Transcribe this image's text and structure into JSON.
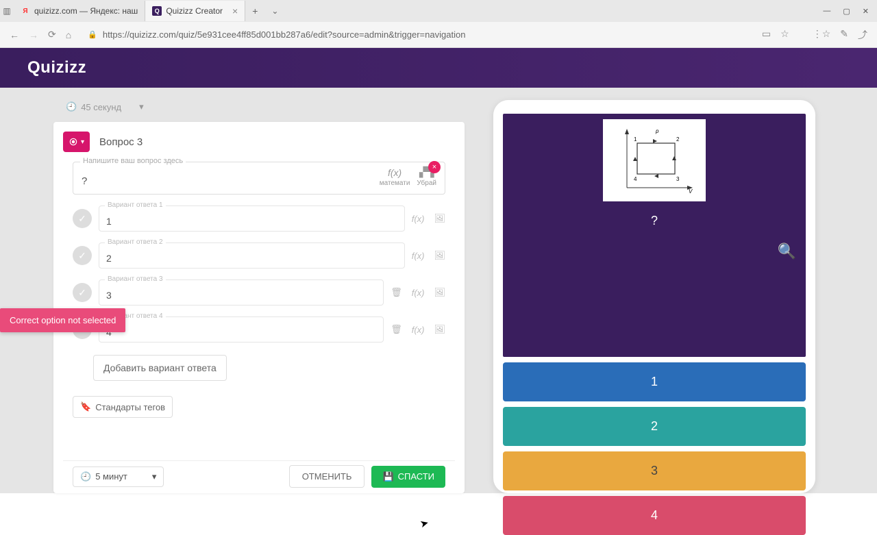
{
  "browser": {
    "tab1": "quizizz.com — Яндекс: наш",
    "tab2": "Quizizz Creator",
    "url": "https://quizizz.com/quiz/5e931cee4ff85d001bb287a6/edit?source=admin&trigger=navigation"
  },
  "logo": "Quizizz",
  "timer_top": "45 секунд",
  "question": {
    "title": "Вопрос 3",
    "placeholder": "Напишите ваш вопрос здесь",
    "value": "?",
    "math_label": "математи",
    "remove_label": "Убрай"
  },
  "error": "Correct option not selected",
  "answers": [
    {
      "label": "Вариант ответа 1",
      "value": "1"
    },
    {
      "label": "Вариант ответа 2",
      "value": "2"
    },
    {
      "label": "Вариант ответа 3",
      "value": "3"
    },
    {
      "label": "Вариант ответа 4",
      "value": "4"
    }
  ],
  "add_option": "Добавить вариант ответа",
  "standards": "Стандарты тегов",
  "duration": "5 минут",
  "cancel": "ОТМЕНИТЬ",
  "save": "СПАСТИ",
  "preview": {
    "question": "?",
    "options": [
      "1",
      "2",
      "3",
      "4"
    ]
  }
}
